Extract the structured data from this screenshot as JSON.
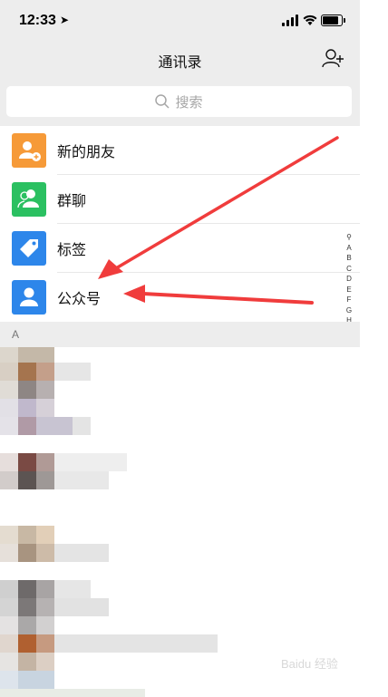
{
  "status": {
    "time": "12:33",
    "location_icon": "location-arrow-icon"
  },
  "nav": {
    "title": "通讯录",
    "add_icon": "add-contact-icon"
  },
  "search": {
    "placeholder": "搜索"
  },
  "menu": [
    {
      "label": "新的朋友",
      "color": "#f69a38",
      "icon": "new-friend-icon"
    },
    {
      "label": "群聊",
      "color": "#2bc061",
      "icon": "group-chat-icon"
    },
    {
      "label": "标签",
      "color": "#2d86ea",
      "icon": "tag-icon"
    },
    {
      "label": "公众号",
      "color": "#2d86ea",
      "icon": "official-account-icon"
    }
  ],
  "index": [
    "A",
    "B",
    "C",
    "D",
    "E",
    "F",
    "G",
    "H"
  ],
  "section": {
    "letter": "A"
  },
  "colors": {
    "accent": "#f03c3c",
    "bar": "#ededed"
  }
}
